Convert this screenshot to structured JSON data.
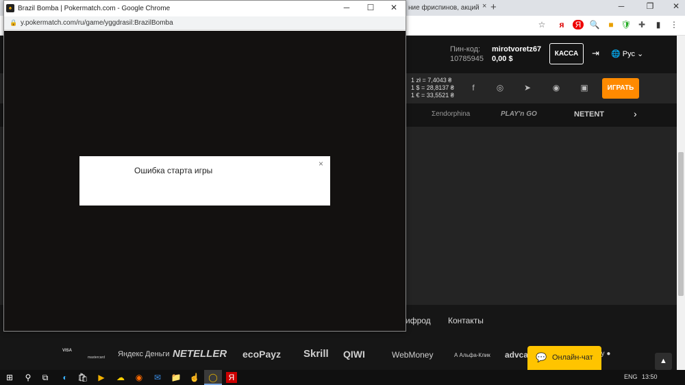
{
  "main_window": {
    "background_tab_title": "ние фриспинов, акций",
    "tab_close": "×",
    "new_tab": "+",
    "controls": {
      "minimize": "─",
      "restore": "❐",
      "close": "✕"
    },
    "toolbar_icons": [
      "☆",
      "я",
      "Я",
      "🔍",
      "■",
      "🛡",
      "✚",
      "▮",
      "⋮"
    ]
  },
  "site": {
    "pin_label": "Пин-код:",
    "pin_value": "10785945",
    "username": "mirotvoretz67",
    "balance": "0,00 $",
    "kassa_label": "КАССА",
    "logout_icon": "⇥",
    "language": "🌐 Рус ⌄",
    "rates": [
      "1 zł = 7,4043 ₴",
      "1 $ = 28,8137 ₴",
      "1 € = 33,5521 ₴"
    ],
    "social_icons": [
      "f",
      "◎",
      "➤",
      "◉",
      "▣"
    ],
    "play_label": "ИГРАТЬ",
    "providers": [
      "Ʃendorphina",
      "PLAY'n GO",
      "NETENT"
    ],
    "providers_next": "›",
    "footer_links": [
      "ифрод",
      "Контакты"
    ],
    "payments": [
      "VISA",
      "mastercard",
      "Яндекс Деньги",
      "NETELLER",
      "ecoPayz",
      "Skrill",
      "QIWI",
      "WebMoney",
      "А Альфа-Клик",
      "advca",
      "ey ●"
    ],
    "chat_label": "Онлайн-чат",
    "chat_icon": "💬",
    "scroll_top": "▲"
  },
  "popup": {
    "title": "Brazil Bomba | Pokermatch.com - Google Chrome",
    "favicon": "♠",
    "controls": {
      "minimize": "─",
      "maximize": "☐",
      "close": "✕"
    },
    "url": "y.pokermatch.com/ru/game/yggdrasil:BrazilBomba",
    "lock_icon": "🔒",
    "error_message": "Ошибка старта игры",
    "error_close": "×"
  },
  "taskbar": {
    "icons": [
      "⊞",
      "⚲",
      "⧉",
      "◐",
      "🛍",
      "▶",
      "☁",
      "◉",
      "✉",
      "📁",
      "☝",
      "◯",
      "Я"
    ],
    "tray": {
      "language": "ENG",
      "time": "13:50"
    }
  }
}
